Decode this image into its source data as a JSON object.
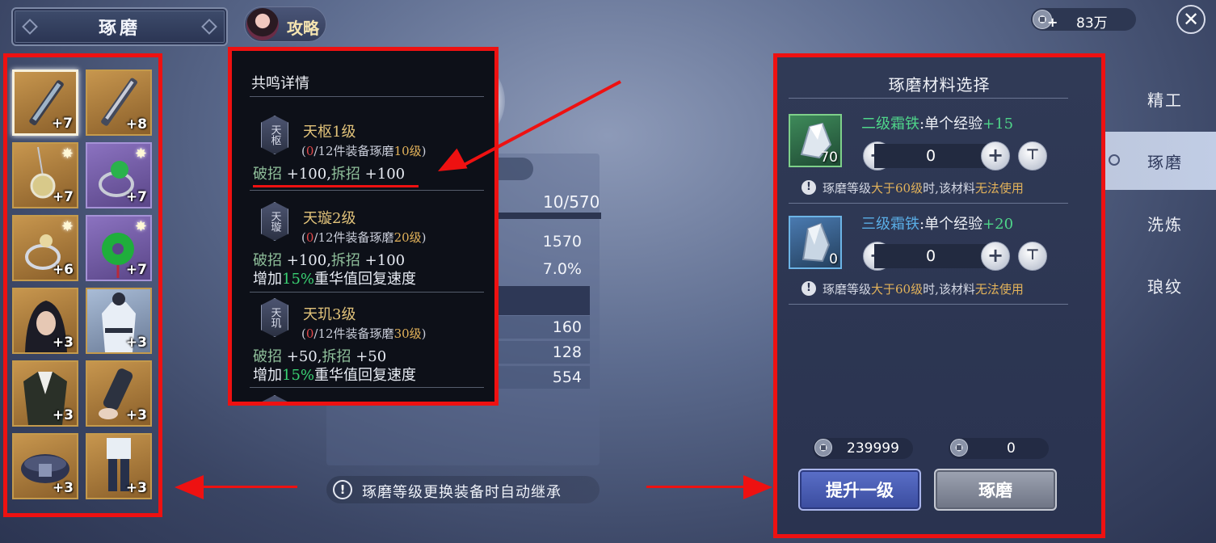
{
  "header": {
    "title": "琢磨",
    "guide_label": "攻略",
    "currency": "83万"
  },
  "equipment": [
    {
      "level": "+7",
      "selected": true,
      "rarity": "gold",
      "icon": "sword-icon"
    },
    {
      "level": "+8",
      "rarity": "gold",
      "icon": "blade-icon"
    },
    {
      "level": "+7",
      "rarity": "gold",
      "icon": "pendant-icon"
    },
    {
      "level": "+7",
      "rarity": "purple",
      "icon": "jade-ring-icon"
    },
    {
      "level": "+6",
      "rarity": "gold",
      "icon": "silver-ring-icon"
    },
    {
      "level": "+7",
      "rarity": "purple",
      "icon": "jade-pendant-icon"
    },
    {
      "level": "+3",
      "rarity": "gold",
      "icon": "head-portrait-icon"
    },
    {
      "level": "+3",
      "rarity": "blue",
      "icon": "white-robe-icon"
    },
    {
      "level": "+3",
      "rarity": "gold",
      "icon": "black-robe-icon"
    },
    {
      "level": "+3",
      "rarity": "gold",
      "icon": "bracer-icon"
    },
    {
      "level": "+3",
      "rarity": "gold",
      "icon": "belt-icon"
    },
    {
      "level": "+3",
      "rarity": "gold",
      "icon": "boots-icon"
    }
  ],
  "resonance": {
    "title": "共鸣详情",
    "tiers": [
      {
        "badge": "天枢",
        "name": "天枢1级",
        "req_count": "0",
        "req_text": "/12件装备琢磨",
        "req_level": "10级",
        "bonus_a_label": "破招",
        "bonus_a_value": "+100",
        "bonus_b_label": "拆招",
        "bonus_b_value": "+100"
      },
      {
        "badge": "天璇",
        "name": "天璇2级",
        "req_count": "0",
        "req_text": "/12件装备琢磨",
        "req_level": "20级",
        "bonus_a_label": "破招",
        "bonus_a_value": "+100",
        "bonus_b_label": "拆招",
        "bonus_b_value": "+100",
        "extra_prefix": "增加",
        "extra_pct": "15%",
        "extra_suffix": "重华值回复速度"
      },
      {
        "badge": "天玑",
        "name": "天玑3级",
        "req_count": "0",
        "req_text": "/12件装备琢磨",
        "req_level": "30级",
        "bonus_a_label": "破招",
        "bonus_a_value": "+50",
        "bonus_b_label": "拆招",
        "bonus_b_value": "+50",
        "extra_prefix": "增加",
        "extra_pct": "15%",
        "extra_suffix": "重华值回复速度"
      }
    ]
  },
  "stats": {
    "exp": "10/570",
    "exp_fraction": 0.0175,
    "values": [
      "1570",
      "7.0%"
    ],
    "rows": [
      "160",
      "128",
      "554"
    ]
  },
  "notice": "琢磨等级更换装备时自动继承",
  "materials": {
    "title": "琢磨材料选择",
    "items": [
      {
        "name": "二级霜铁",
        "exp_label": ":单个经验",
        "exp_value": "+15",
        "count": "70",
        "qty": "0",
        "warn_prefix": "琢磨等级",
        "warn_mid_orange": "大于60级",
        "warn_mid": "时,该材料",
        "warn_end_orange": "无法使用",
        "color": "#4fd68a"
      },
      {
        "name": "三级霜铁",
        "exp_label": ":单个经验",
        "exp_value": "+20",
        "count": "0",
        "qty": "0",
        "warn_prefix": "琢磨等级",
        "warn_mid_orange": "大于60级",
        "warn_mid": "时,该材料",
        "warn_end_orange": "无法使用",
        "color": "#5aaee6"
      }
    ],
    "cost_left": "239999",
    "cost_right": "0",
    "upgrade_label": "提升一级",
    "polish_label": "琢磨"
  },
  "tabs": [
    {
      "label": "精工",
      "active": false
    },
    {
      "label": "琢磨",
      "active": true
    },
    {
      "label": "洗炼",
      "active": false
    },
    {
      "label": "琅纹",
      "active": false
    }
  ]
}
